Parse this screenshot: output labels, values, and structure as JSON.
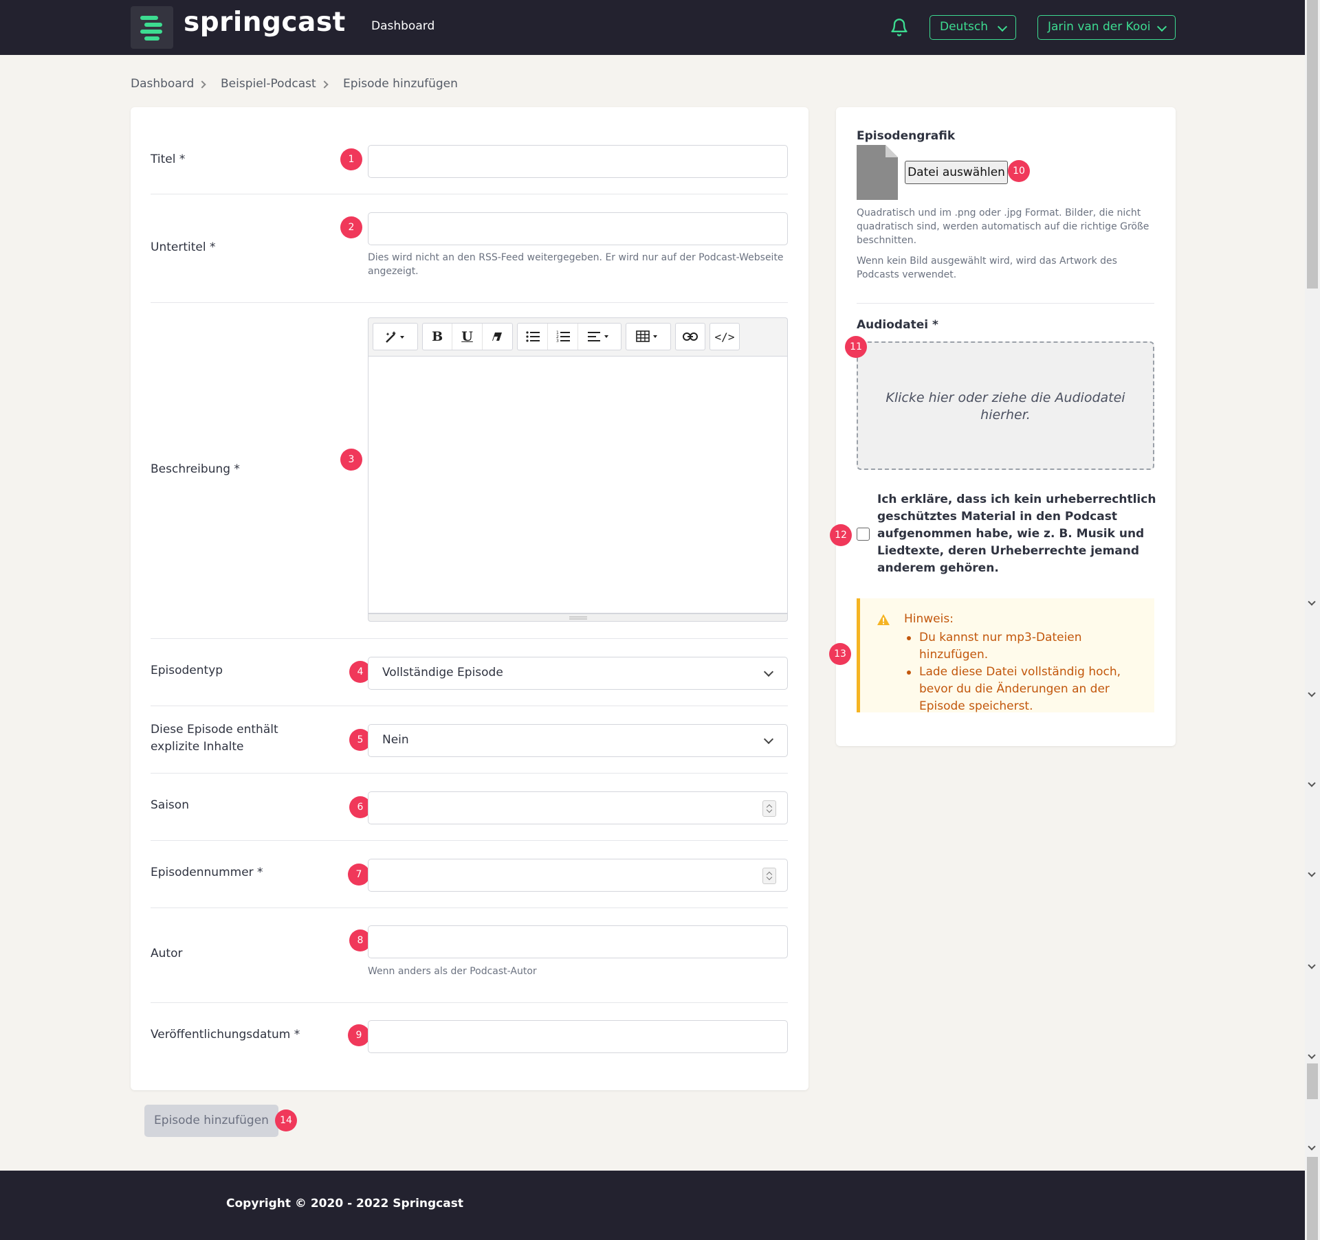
{
  "app": {
    "name": "springcast"
  },
  "nav": {
    "dashboard": "Dashboard",
    "language": "Deutsch",
    "user": "Jarin van der Kooi"
  },
  "breadcrumb": [
    "Dashboard",
    "Beispiel-Podcast",
    "Episode hinzufügen"
  ],
  "form": {
    "title_label": "Titel *",
    "subtitle_label": "Untertitel *",
    "subtitle_help": "Dies wird nicht an den RSS-Feed weitergegeben. Er wird nur auf der Podcast-Webseite angezeigt.",
    "description_label": "Beschreibung *",
    "episode_type_label": "Episodentyp",
    "episode_type_value": "Vollständige Episode",
    "explicit_label": "Diese Episode enthält explizite Inhalte",
    "explicit_value": "Nein",
    "season_label": "Saison",
    "episode_number_label": "Episodennummer *",
    "author_label": "Autor",
    "author_help": "Wenn anders als der Podcast-Autor",
    "publish_date_label": "Veröffentlichungsdatum *",
    "submit_label": "Episode hinzufügen"
  },
  "toolbar": {
    "bold": "B",
    "underline": "U",
    "code": "</>"
  },
  "sidebar": {
    "image_heading": "Episodengrafik",
    "file_button": "Datei auswählen",
    "image_note_1": "Quadratisch und im .png oder .jpg Format. Bilder, die nicht quadratisch sind, werden automatisch auf die richtige Größe beschnitten.",
    "image_note_2": "Wenn kein Bild ausgewählt wird, wird das Artwork des Podcasts verwendet.",
    "audio_heading": "Audiodatei *",
    "dropzone_text": "Klicke hier oder ziehe die Audiodatei hierher.",
    "copyright_declaration": "Ich erkläre, dass ich kein urheberrechtlich geschütztes Material in den Podcast aufgenommen habe, wie z. B. Musik und Liedtexte, deren Urheberrechte jemand anderem gehören.",
    "notice_title": "Hinweis:",
    "notice_items": [
      "Du kannst nur mp3-Dateien hinzufügen.",
      "Lade diese Datei vollständig hoch, bevor du die Änderungen an der Episode speicherst."
    ]
  },
  "badges": [
    "1",
    "2",
    "3",
    "4",
    "5",
    "6",
    "7",
    "8",
    "9",
    "10",
    "11",
    "12",
    "13",
    "14"
  ],
  "footer": {
    "copyright": "Copyright © 2020 - 2022 Springcast"
  },
  "colors": {
    "accent": "#3ddc91",
    "navbar": "#23222f",
    "badge": "#f0385a",
    "warning": "#f5b423"
  }
}
